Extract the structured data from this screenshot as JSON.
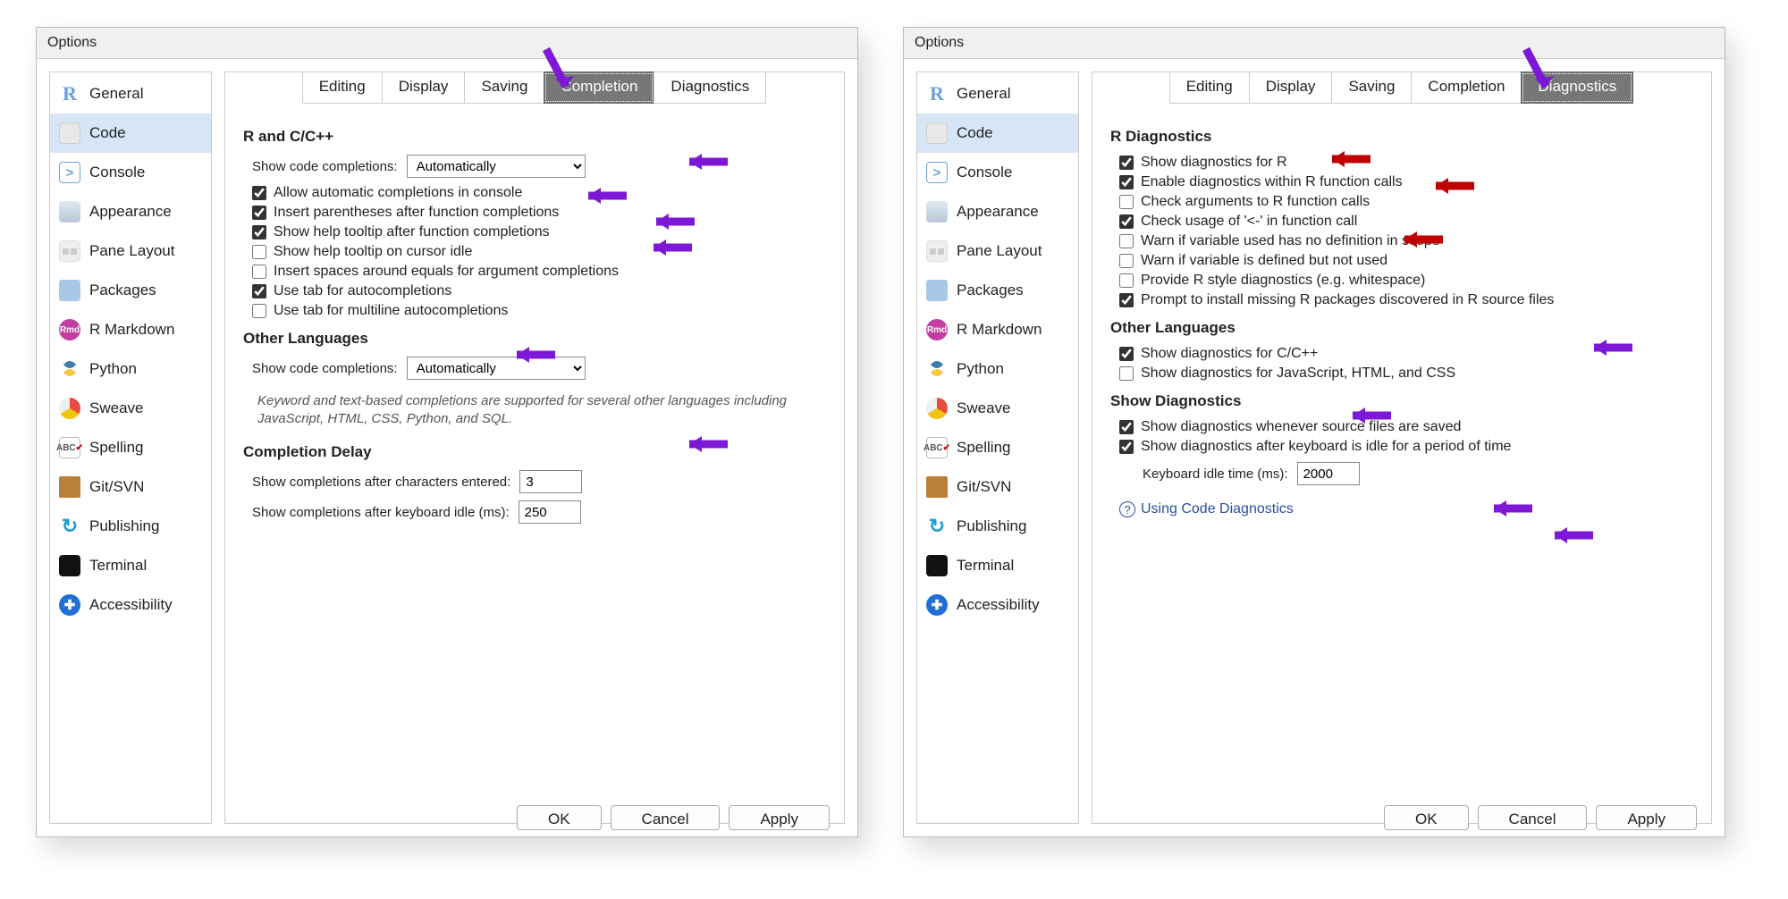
{
  "dialog_title": "Options",
  "sidebar": [
    {
      "label": "General"
    },
    {
      "label": "Code"
    },
    {
      "label": "Console"
    },
    {
      "label": "Appearance"
    },
    {
      "label": "Pane Layout"
    },
    {
      "label": "Packages"
    },
    {
      "label": "R Markdown"
    },
    {
      "label": "Python"
    },
    {
      "label": "Sweave"
    },
    {
      "label": "Spelling"
    },
    {
      "label": "Git/SVN"
    },
    {
      "label": "Publishing"
    },
    {
      "label": "Terminal"
    },
    {
      "label": "Accessibility"
    }
  ],
  "tabs": {
    "editing": "Editing",
    "display": "Display",
    "saving": "Saving",
    "completion": "Completion",
    "diagnostics": "Diagnostics"
  },
  "buttons": {
    "ok": "OK",
    "cancel": "Cancel",
    "apply": "Apply"
  },
  "left": {
    "sec1": "R and C/C++",
    "show_completions_label": "Show code completions:",
    "show_completions_value": "Automatically",
    "c1": {
      "label": "Allow automatic completions in console",
      "checked": true
    },
    "c2": {
      "label": "Insert parentheses after function completions",
      "checked": true
    },
    "c3": {
      "label": "Show help tooltip after function completions",
      "checked": true
    },
    "c4": {
      "label": "Show help tooltip on cursor idle",
      "checked": false
    },
    "c5": {
      "label": "Insert spaces around equals for argument completions",
      "checked": false
    },
    "c6": {
      "label": "Use tab for autocompletions",
      "checked": true
    },
    "c7": {
      "label": "Use tab for multiline autocompletions",
      "checked": false
    },
    "sec2": "Other Languages",
    "show_completions2_value": "Automatically",
    "note": "Keyword and text-based completions are supported for several other languages including JavaScript, HTML, CSS, Python, and SQL.",
    "sec3": "Completion Delay",
    "after_chars_label": "Show completions after characters entered:",
    "after_chars_value": "3",
    "after_idle_label": "Show completions after keyboard idle (ms):",
    "after_idle_value": "250"
  },
  "right": {
    "sec1": "R Diagnostics",
    "d1": {
      "label": "Show diagnostics for R",
      "checked": true
    },
    "d2": {
      "label": "Enable diagnostics within R function calls",
      "checked": true
    },
    "d3": {
      "label": "Check arguments to R function calls",
      "checked": false
    },
    "d4": {
      "label": "Check usage of '<-' in function call",
      "checked": true
    },
    "d5": {
      "label": "Warn if variable used has no definition in scope",
      "checked": false
    },
    "d6": {
      "label": "Warn if variable is defined but not used",
      "checked": false
    },
    "d7": {
      "label": "Provide R style diagnostics (e.g. whitespace)",
      "checked": false
    },
    "d8": {
      "label": "Prompt to install missing R packages discovered in R source files",
      "checked": true
    },
    "sec2": "Other Languages",
    "d9": {
      "label": "Show diagnostics for C/C++",
      "checked": true
    },
    "d10": {
      "label": "Show diagnostics for JavaScript, HTML, and CSS",
      "checked": false
    },
    "sec3": "Show Diagnostics",
    "d11": {
      "label": "Show diagnostics whenever source files are saved",
      "checked": true
    },
    "d12": {
      "label": "Show diagnostics after keyboard is idle for a period of time",
      "checked": true
    },
    "idle_label": "Keyboard idle time (ms):",
    "idle_value": "2000",
    "help": "Using Code Diagnostics"
  }
}
